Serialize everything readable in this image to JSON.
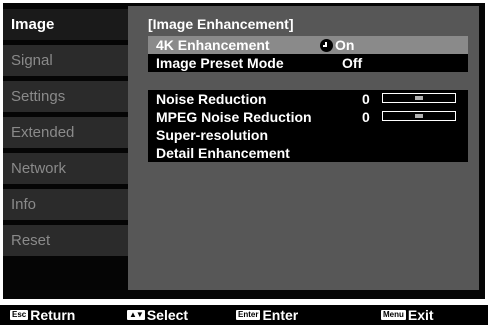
{
  "sidebar": {
    "items": [
      {
        "label": "Image",
        "active": true
      },
      {
        "label": "Signal",
        "active": false
      },
      {
        "label": "Settings",
        "active": false
      },
      {
        "label": "Extended",
        "active": false
      },
      {
        "label": "Network",
        "active": false
      },
      {
        "label": "Info",
        "active": false
      },
      {
        "label": "Reset",
        "active": false
      }
    ]
  },
  "panel": {
    "title": "[Image Enhancement]",
    "rows": [
      {
        "label": "4K Enhancement",
        "value": "On",
        "selected": true,
        "icon": "enter-icon"
      },
      {
        "label": "Image Preset Mode",
        "value": "Off"
      },
      {
        "label": "Noise Reduction",
        "value": "0",
        "slider": 0.5
      },
      {
        "label": "MPEG Noise Reduction",
        "value": "0",
        "slider": 0.5
      },
      {
        "label": "Super-resolution"
      },
      {
        "label": "Detail Enhancement"
      }
    ]
  },
  "footer": {
    "return_key": "Esc",
    "return_label": "Return",
    "select_key": "▲▼",
    "select_label": "Select",
    "enter_key": "Enter",
    "enter_label": "Enter",
    "exit_key": "Menu",
    "exit_label": "Exit"
  },
  "colors": {
    "panel_bg": "#575757",
    "highlight": "#8a8a8a",
    "sidebar_inactive": "#2b2b2b"
  }
}
